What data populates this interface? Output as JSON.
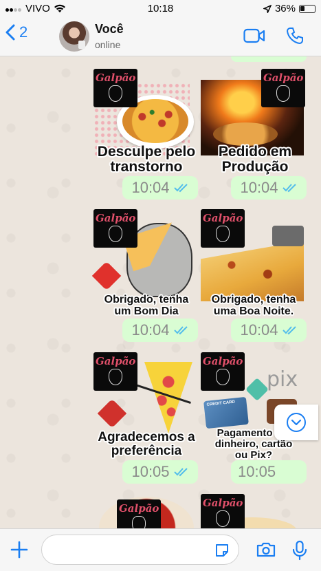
{
  "status_bar": {
    "carrier": "VIVO",
    "time": "10:18",
    "battery": "36%",
    "battery_level": 0.36
  },
  "header": {
    "back_count": "2",
    "contact_name": "Você",
    "contact_status": "online"
  },
  "stickers": [
    {
      "logo": "Galpão",
      "caption": "Desculpe pelo\ntranstorno",
      "time": "10:04",
      "image": "pizza-slice-hearts"
    },
    {
      "logo": "Galpão",
      "caption": "Pedido em\nProdução",
      "time": "10:04",
      "image": "pizza-oven"
    },
    {
      "logo": "Galpão",
      "caption": "Obrigado, tenha\num Bom Dia",
      "time": "10:04",
      "image": "cat-eating-pizza"
    },
    {
      "logo": "Galpão",
      "caption": "Obrigado, tenha\numa Boa Noite.",
      "time": "10:04",
      "image": "cheese-pizza-slice"
    },
    {
      "logo": "Galpão",
      "caption": "Agradecemos a\npreferência",
      "time": "10:05",
      "image": "pizza-heart-arrow"
    },
    {
      "logo": "Galpão",
      "caption": "Pagamento em\ndinheiro, cartão\nou Pix?",
      "time": "10:05",
      "image": "payment-methods"
    }
  ],
  "extras": {
    "pix_label": "pix",
    "credit_card_label": "CREDIT CARD"
  },
  "composer": {
    "placeholder": ""
  },
  "colors": {
    "accent": "#1a7ef2",
    "bubble": "#d9fdd3",
    "read_ticks": "#53bdeb",
    "logo_text": "#e0506a"
  }
}
